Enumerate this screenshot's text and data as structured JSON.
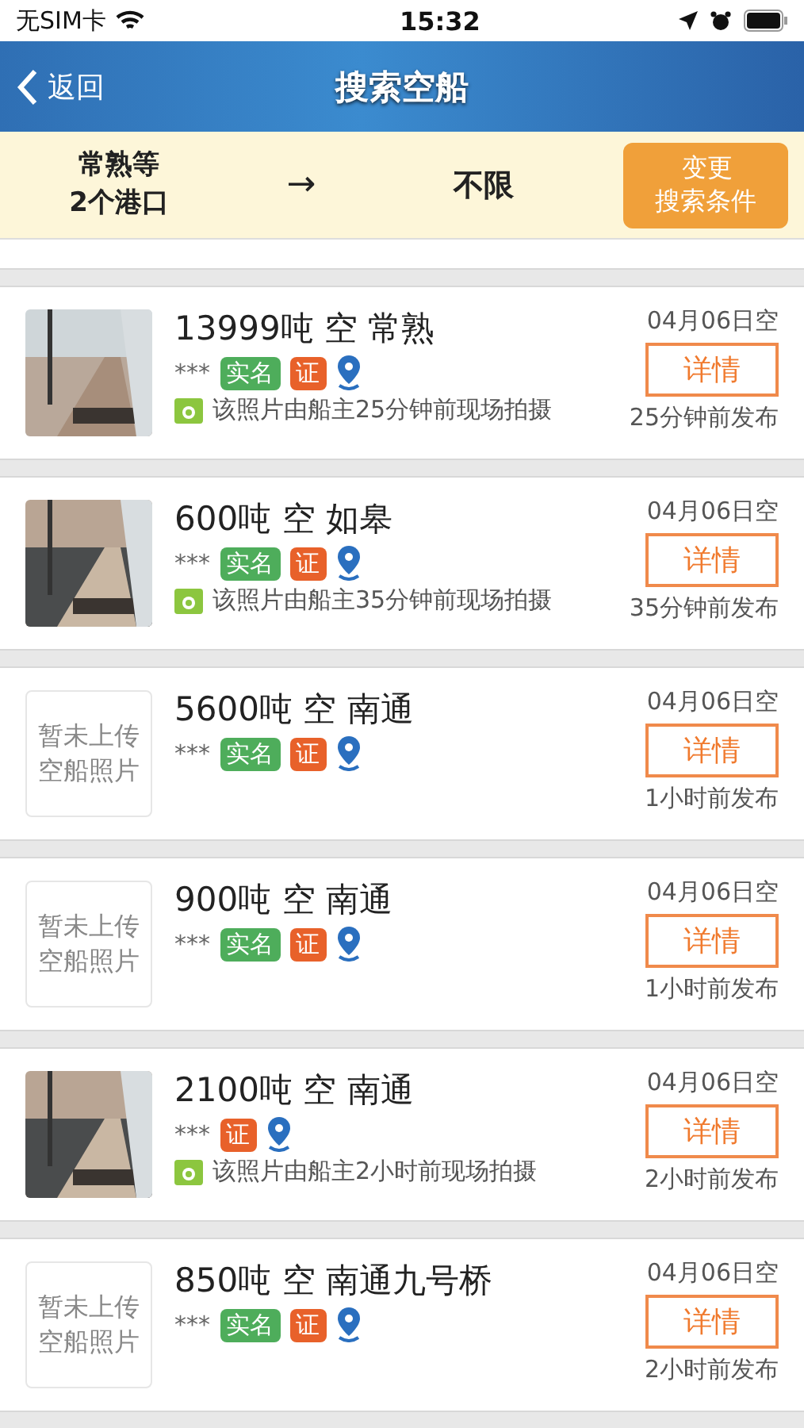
{
  "status_bar": {
    "carrier": "无SIM卡",
    "time": "15:32"
  },
  "nav": {
    "back": "返回",
    "title": "搜索空船"
  },
  "filter": {
    "origin": "常熟等",
    "origin_count": "2个港口",
    "arrow": "→",
    "destination": "不限",
    "change_button": "变更搜索条件"
  },
  "ships": [
    {
      "thumb": {
        "kind": "picture"
      },
      "title": "13999吨 空 常熟",
      "owner": "***",
      "badges": [
        {
          "kind": "real_name",
          "label": "实名"
        },
        {
          "kind": "cert",
          "label": "证"
        }
      ],
      "photo_note": "该照片由船主25分钟前现场拍摄",
      "date": "04月06日空",
      "detail": "详情",
      "posted": "25分钟前发布"
    },
    {
      "thumb": {
        "kind": "picture"
      },
      "title": "600吨 空 如皋",
      "owner": "***",
      "badges": [
        {
          "kind": "real_name",
          "label": "实名"
        },
        {
          "kind": "cert",
          "label": "证"
        }
      ],
      "photo_note": "该照片由船主35分钟前现场拍摄",
      "date": "04月06日空",
      "detail": "详情",
      "posted": "35分钟前发布"
    },
    {
      "thumb": {
        "kind": "placeholder",
        "text": "暂未上传空船照片"
      },
      "title": "5600吨 空 南通",
      "owner": "***",
      "badges": [
        {
          "kind": "real_name",
          "label": "实名"
        },
        {
          "kind": "cert",
          "label": "证"
        }
      ],
      "date": "04月06日空",
      "detail": "详情",
      "posted": "1小时前发布"
    },
    {
      "thumb": {
        "kind": "placeholder",
        "text": "暂未上传空船照片"
      },
      "title": "900吨 空 南通",
      "owner": "***",
      "badges": [
        {
          "kind": "real_name",
          "label": "实名"
        },
        {
          "kind": "cert",
          "label": "证"
        }
      ],
      "date": "04月06日空",
      "detail": "详情",
      "posted": "1小时前发布"
    },
    {
      "thumb": {
        "kind": "picture"
      },
      "title": "2100吨 空 南通",
      "owner": "***",
      "badges": [
        {
          "kind": "cert",
          "label": "证"
        }
      ],
      "photo_note": "该照片由船主2小时前现场拍摄",
      "date": "04月06日空",
      "detail": "详情",
      "posted": "2小时前发布"
    },
    {
      "thumb": {
        "kind": "placeholder",
        "text": "暂未上传空船照片"
      },
      "title": "850吨 空 南通九号桥",
      "owner": "***",
      "badges": [
        {
          "kind": "real_name",
          "label": "实名"
        },
        {
          "kind": "cert",
          "label": "证"
        }
      ],
      "date": "04月06日空",
      "detail": "详情",
      "posted": "2小时前发布"
    }
  ]
}
